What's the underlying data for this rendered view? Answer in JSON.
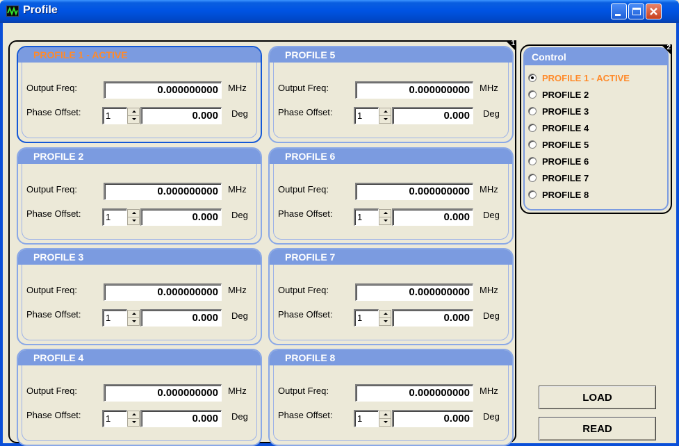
{
  "window": {
    "title": "Profile",
    "icon": "waveform-icon"
  },
  "main_group": {
    "badge": "1"
  },
  "profiles": [
    {
      "title": "PROFILE 1 - ACTIVE",
      "active": true,
      "freq_label": "Output Freq:",
      "freq_value": "0.000000000",
      "freq_unit": "MHz",
      "phase_label": "Phase Offset:",
      "phase_index": "1",
      "phase_value": "0.000",
      "phase_unit": "Deg"
    },
    {
      "title": "PROFILE 2",
      "active": false,
      "freq_label": "Output Freq:",
      "freq_value": "0.000000000",
      "freq_unit": "MHz",
      "phase_label": "Phase Offset:",
      "phase_index": "1",
      "phase_value": "0.000",
      "phase_unit": "Deg"
    },
    {
      "title": "PROFILE 3",
      "active": false,
      "freq_label": "Output Freq:",
      "freq_value": "0.000000000",
      "freq_unit": "MHz",
      "phase_label": "Phase Offset:",
      "phase_index": "1",
      "phase_value": "0.000",
      "phase_unit": "Deg"
    },
    {
      "title": "PROFILE 4",
      "active": false,
      "freq_label": "Output Freq:",
      "freq_value": "0.000000000",
      "freq_unit": "MHz",
      "phase_label": "Phase Offset:",
      "phase_index": "1",
      "phase_value": "0.000",
      "phase_unit": "Deg"
    },
    {
      "title": "PROFILE 5",
      "active": false,
      "freq_label": "Output Freq:",
      "freq_value": "0.000000000",
      "freq_unit": "MHz",
      "phase_label": "Phase Offset:",
      "phase_index": "1",
      "phase_value": "0.000",
      "phase_unit": "Deg"
    },
    {
      "title": "PROFILE 6",
      "active": false,
      "freq_label": "Output Freq:",
      "freq_value": "0.000000000",
      "freq_unit": "MHz",
      "phase_label": "Phase Offset:",
      "phase_index": "1",
      "phase_value": "0.000",
      "phase_unit": "Deg"
    },
    {
      "title": "PROFILE 7",
      "active": false,
      "freq_label": "Output Freq:",
      "freq_value": "0.000000000",
      "freq_unit": "MHz",
      "phase_label": "Phase Offset:",
      "phase_index": "1",
      "phase_value": "0.000",
      "phase_unit": "Deg"
    },
    {
      "title": "PROFILE 8",
      "active": false,
      "freq_label": "Output Freq:",
      "freq_value": "0.000000000",
      "freq_unit": "MHz",
      "phase_label": "Phase Offset:",
      "phase_index": "1",
      "phase_value": "0.000",
      "phase_unit": "Deg"
    }
  ],
  "control": {
    "title": "Control",
    "badge": "2",
    "options": [
      {
        "label": "PROFILE 1 - ACTIVE",
        "selected": true
      },
      {
        "label": "PROFILE 2",
        "selected": false
      },
      {
        "label": "PROFILE 3",
        "selected": false
      },
      {
        "label": "PROFILE 4",
        "selected": false
      },
      {
        "label": "PROFILE 5",
        "selected": false
      },
      {
        "label": "PROFILE 6",
        "selected": false
      },
      {
        "label": "PROFILE 7",
        "selected": false
      },
      {
        "label": "PROFILE 8",
        "selected": false
      }
    ]
  },
  "buttons": {
    "load": "LOAD",
    "read": "READ"
  },
  "colors": {
    "active_title": "#ff8a2a",
    "header_blue": "#7b9be0",
    "titlebar": "#0054e3"
  }
}
